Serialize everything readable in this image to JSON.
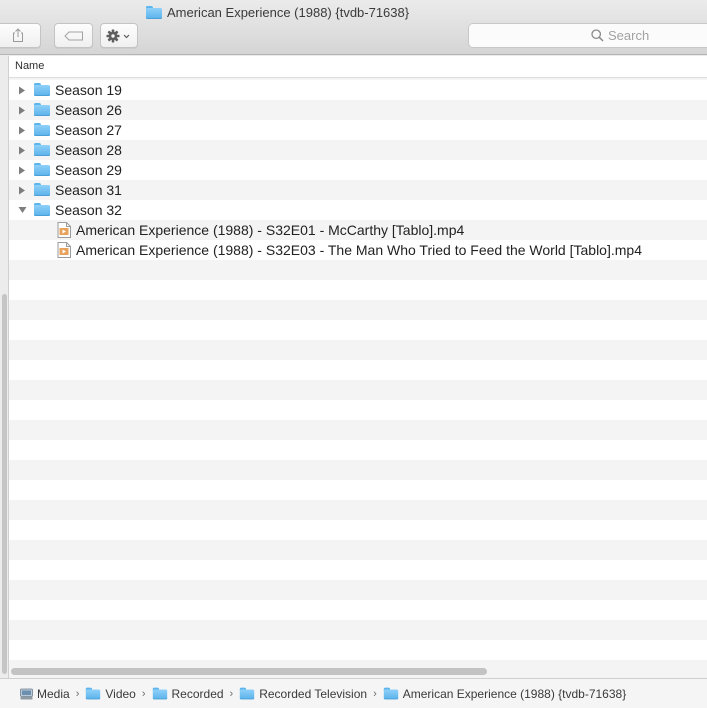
{
  "window": {
    "title": "American Experience (1988) {tvdb-71638}"
  },
  "toolbar": {
    "share_icon": "share-icon",
    "tags_icon": "tag-icon",
    "action_icon": "gear-icon",
    "search_placeholder": "Search"
  },
  "list": {
    "column_name": "Name",
    "rows": [
      {
        "type": "folder",
        "label": "Season 19",
        "expanded": false
      },
      {
        "type": "folder",
        "label": "Season 26",
        "expanded": false
      },
      {
        "type": "folder",
        "label": "Season 27",
        "expanded": false
      },
      {
        "type": "folder",
        "label": "Season 28",
        "expanded": false
      },
      {
        "type": "folder",
        "label": "Season 29",
        "expanded": false
      },
      {
        "type": "folder",
        "label": "Season 31",
        "expanded": false
      },
      {
        "type": "folder",
        "label": "Season 32",
        "expanded": true
      },
      {
        "type": "file",
        "label": "American Experience (1988) - S32E01 - McCarthy [Tablo].mp4"
      },
      {
        "type": "file",
        "label": "American Experience (1988) - S32E03 - The Man Who Tried to Feed the World [Tablo].mp4"
      }
    ]
  },
  "pathbar": {
    "crumbs": [
      "Media",
      "Video",
      "Recorded",
      "Recorded Television",
      "American Experience (1988) {tvdb-71638}"
    ]
  },
  "colors": {
    "folder": "#5ab2ea",
    "row_stripe": "#f4f4f4"
  }
}
